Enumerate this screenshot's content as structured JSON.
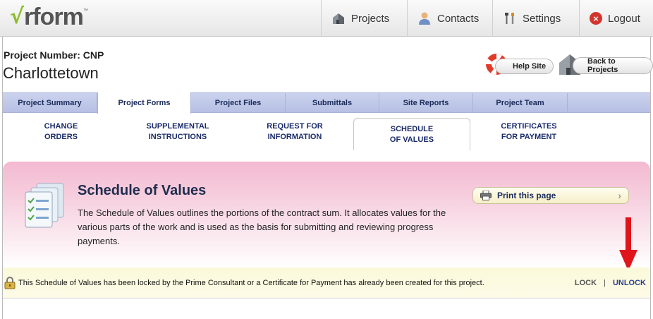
{
  "brand": {
    "logo_check": "√",
    "logo_text": "rform",
    "logo_tm": "™"
  },
  "topnav": {
    "projects": "Projects",
    "contacts": "Contacts",
    "settings": "Settings",
    "logout": "Logout"
  },
  "project": {
    "number_label": "Project Number: CNP",
    "name": "Charlottetown"
  },
  "header_buttons": {
    "help": "Help Site",
    "back": "Back to Projects"
  },
  "tabs": [
    {
      "label": "Project Summary"
    },
    {
      "label": "Project Forms",
      "active": true
    },
    {
      "label": "Project Files"
    },
    {
      "label": "Submittals"
    },
    {
      "label": "Site Reports"
    },
    {
      "label": "Project Team"
    }
  ],
  "subtabs": [
    {
      "line1": "CHANGE",
      "line2": "ORDERS"
    },
    {
      "line1": "SUPPLEMENTAL",
      "line2": "INSTRUCTIONS"
    },
    {
      "line1": "REQUEST FOR",
      "line2": "INFORMATION"
    },
    {
      "line1": "SCHEDULE",
      "line2": "OF VALUES",
      "active": true
    },
    {
      "line1": "CERTIFICATES",
      "line2": "FOR PAYMENT"
    }
  ],
  "content": {
    "title": "Schedule of Values",
    "description": "The Schedule of Values outlines the portions of the contract sum. It allocates values for the various parts of the work and is used as the basis for submitting and reviewing progress payments.",
    "print_label": "Print this page"
  },
  "lockbar": {
    "message": "This Schedule of Values has been locked by the Prime Consultant or a Certificate for Payment has already been created for this project.",
    "lock": "LOCK",
    "separator": "|",
    "unlock": "UNLOCK"
  },
  "colors": {
    "brand_green": "#8dbd2b",
    "tab_bar": "#c2caec",
    "panel_pink": "#f3b9d0",
    "lockbar_yellow": "#fbf9da",
    "arrow_red": "#e0141b",
    "link_blue": "#2a3f8c"
  },
  "icons": {
    "projects": "house-icon",
    "contacts": "person-icon",
    "settings": "tools-icon",
    "logout": "close-circle-icon",
    "help": "lifebuoy-icon",
    "back": "house-icon",
    "print": "printer-icon",
    "lock": "padlock-icon",
    "document": "checklist-document-icon"
  }
}
